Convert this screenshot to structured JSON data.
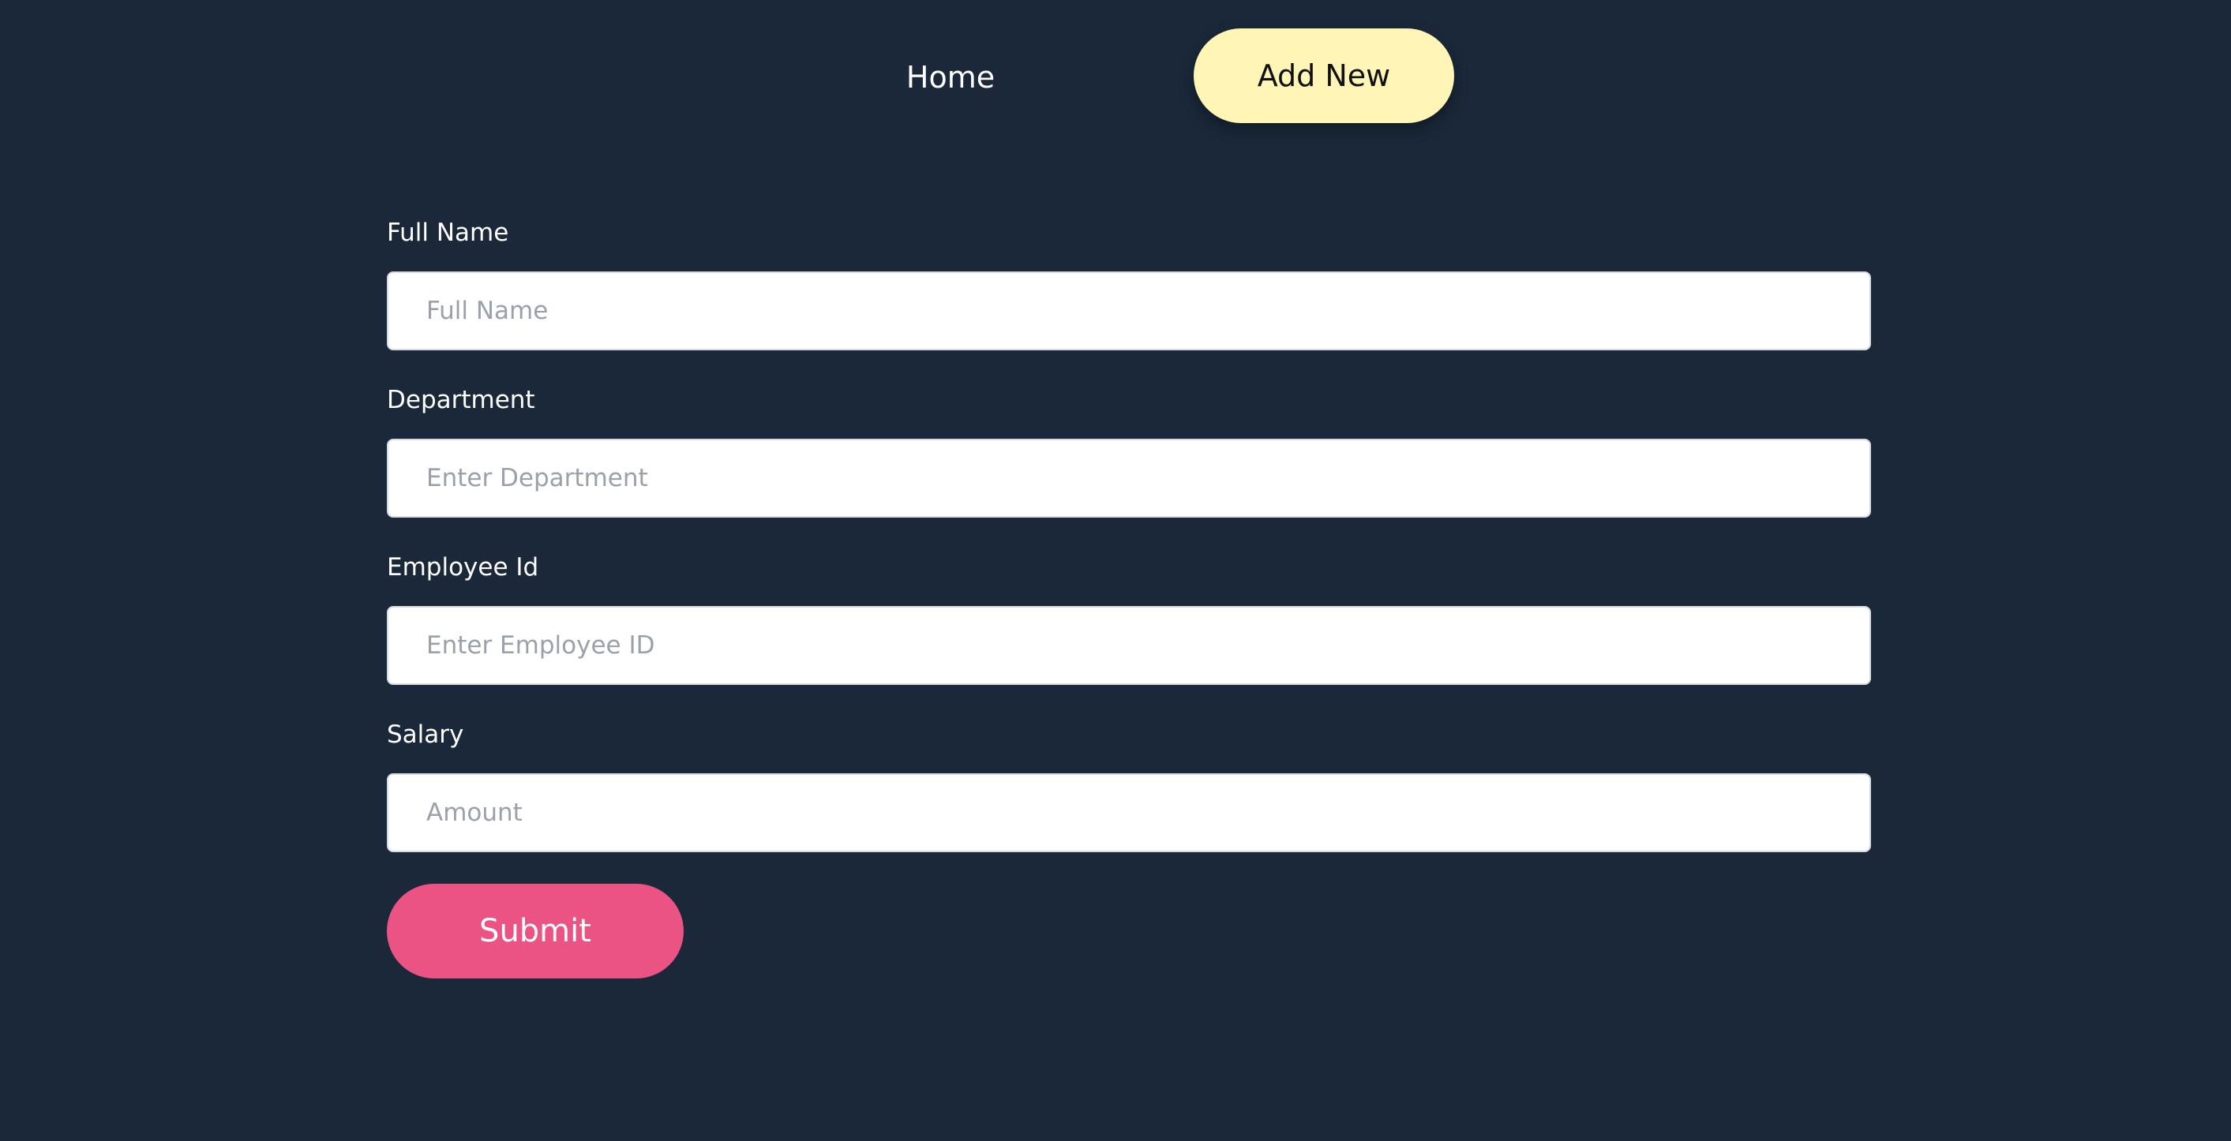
{
  "nav": {
    "home_label": "Home",
    "add_new_label": "Add New"
  },
  "form": {
    "fields": [
      {
        "label": "Full Name",
        "placeholder": "Full Name",
        "value": ""
      },
      {
        "label": "Department",
        "placeholder": "Enter Department",
        "value": ""
      },
      {
        "label": "Employee Id",
        "placeholder": "Enter Employee ID",
        "value": ""
      },
      {
        "label": "Salary",
        "placeholder": "Amount",
        "value": ""
      }
    ],
    "submit_label": "Submit"
  },
  "colors": {
    "background": "#1a2839",
    "add_new_button": "#fef5b7",
    "submit_button": "#eb5384",
    "input_background": "#ffffff",
    "placeholder_text": "#9aa1ab"
  }
}
